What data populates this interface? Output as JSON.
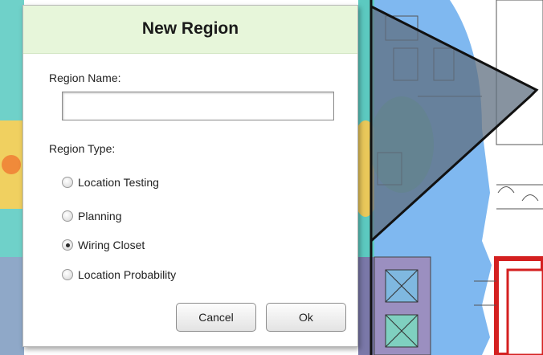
{
  "dialog": {
    "title": "New Region",
    "region_name_label": "Region Name:",
    "region_name_value": "",
    "region_type_label": "Region Type:",
    "region_types": [
      {
        "label": "Location Testing",
        "checked": false
      },
      {
        "label": "Planning",
        "checked": false
      },
      {
        "label": "Wiring Closet",
        "checked": true
      },
      {
        "label": "Location Probability",
        "checked": false
      }
    ],
    "cancel_label": "Cancel",
    "ok_label": "Ok"
  },
  "colors": {
    "header_bg": "#e7f6da",
    "heatmap_blue": "#7fb8f0",
    "region_fill": "#5f6f80",
    "wall_red": "#d42020"
  }
}
